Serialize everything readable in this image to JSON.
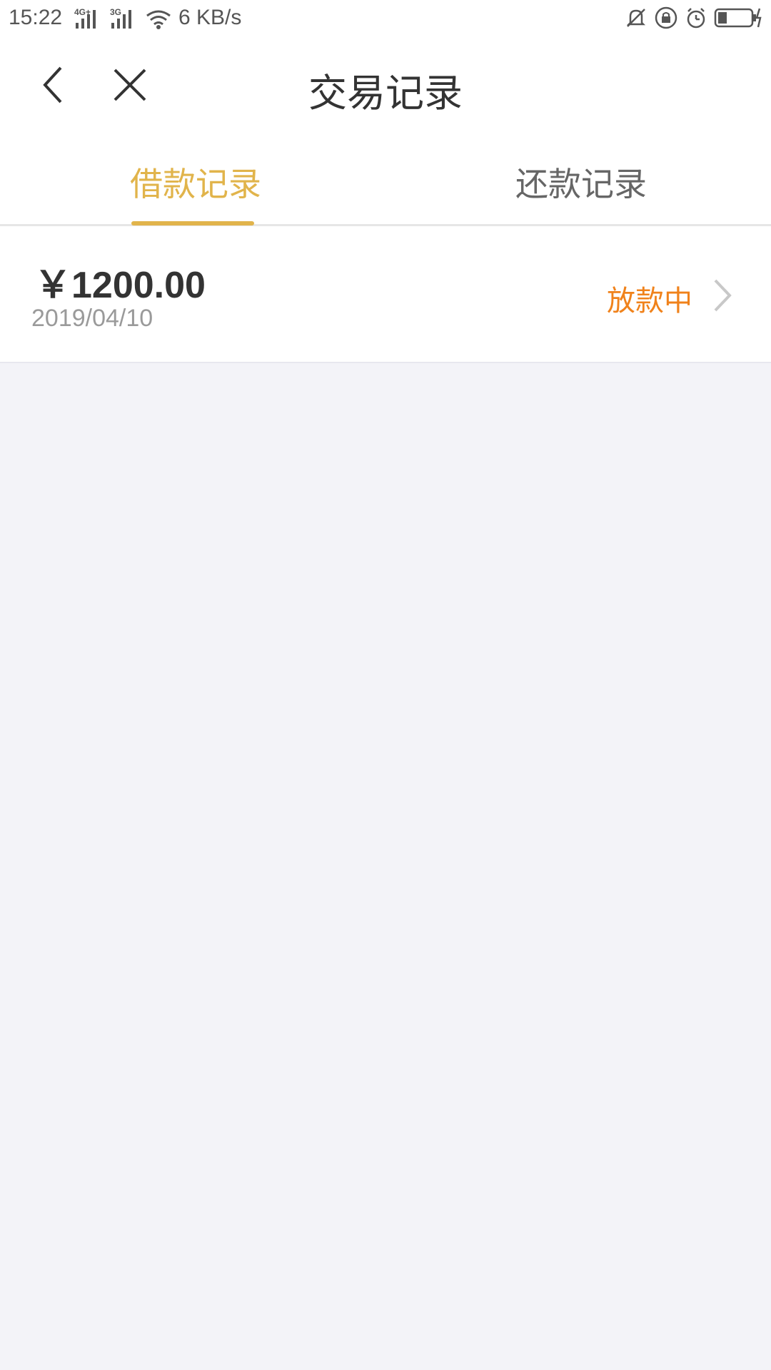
{
  "status_bar": {
    "time": "15:22",
    "signal1_tag": "4G+",
    "signal2_tag": "3G",
    "net_speed": "6 KB/s"
  },
  "header": {
    "title": "交易记录"
  },
  "tabs": [
    {
      "label": "借款记录",
      "active": true
    },
    {
      "label": "还款记录",
      "active": false
    }
  ],
  "records": [
    {
      "amount": "￥1200.00",
      "date": "2019/04/10",
      "status": "放款中"
    }
  ],
  "colors": {
    "accent": "#e1b44b",
    "status_orange": "#f0821b",
    "background": "#f3f3f8"
  }
}
